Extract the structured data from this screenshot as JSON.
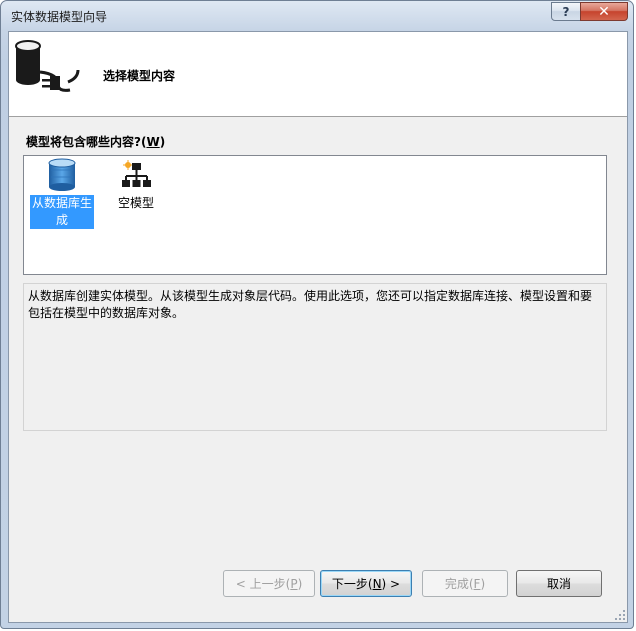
{
  "window": {
    "title": "实体数据模型向导",
    "help_glyph": "?",
    "close_glyph": "✕"
  },
  "header": {
    "title": "选择模型内容",
    "icon": "database-plug-icon"
  },
  "question": {
    "text": "模型将包含哪些内容?(",
    "mnemonic": "W",
    "suffix": ")"
  },
  "options": [
    {
      "label": "从数据库生成",
      "icon": "database-icon",
      "selected": true
    },
    {
      "label": "空模型",
      "icon": "hierarchy-icon",
      "selected": false
    }
  ],
  "description": "从数据库创建实体模型。从该模型生成对象层代码。使用此选项，您还可以指定数据库连接、模型设置和要包括在模型中的数据库对象。",
  "buttons": {
    "prev": {
      "prefix": "< 上一步(",
      "mnemonic": "P",
      "suffix": ")",
      "enabled": false
    },
    "next": {
      "prefix": "下一步(",
      "mnemonic": "N",
      "suffix": ") >",
      "enabled": true
    },
    "finish": {
      "prefix": "完成(",
      "mnemonic": "F",
      "suffix": ")",
      "enabled": false
    },
    "cancel": {
      "label": "取消",
      "enabled": true
    }
  },
  "colors": {
    "selection": "#3399ff",
    "client_bg": "#f0f0f0",
    "close_red": "#c6432d"
  }
}
